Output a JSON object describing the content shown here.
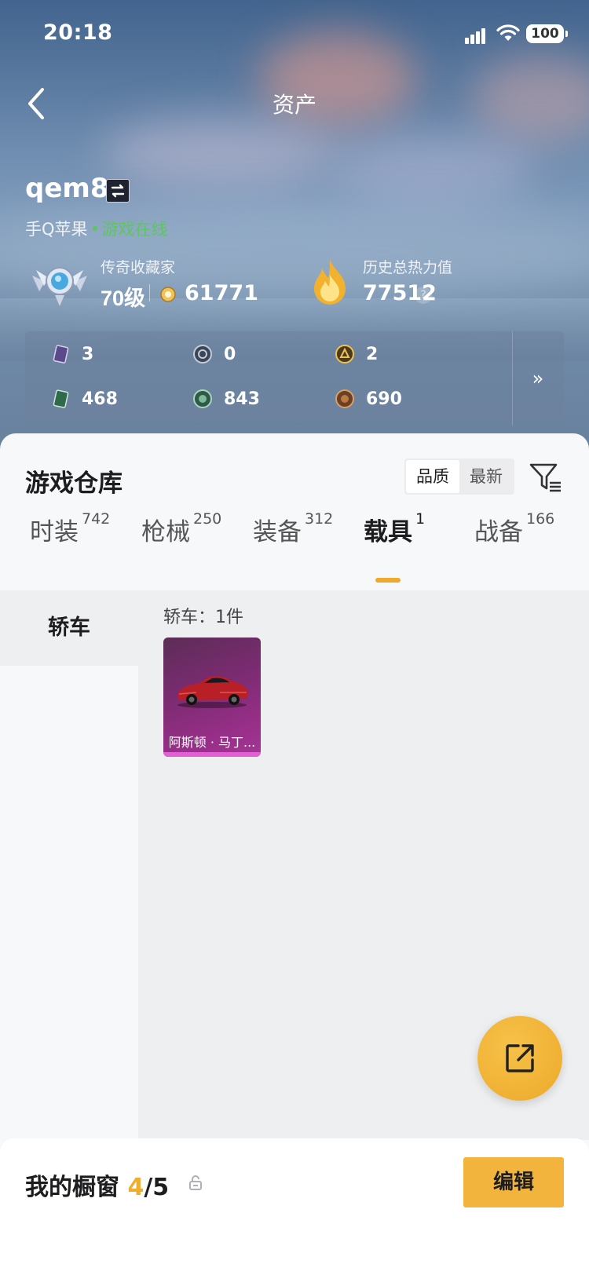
{
  "status_bar": {
    "time": "20:18",
    "battery": "100"
  },
  "nav": {
    "title": "资产"
  },
  "profile": {
    "username": "qem8",
    "platform": "手Q苹果",
    "online_status": "游戏在线",
    "collector_title": "传奇收藏家",
    "level": "70级",
    "points": "61771",
    "heat_label": "历史总热力值",
    "heat_value": "77512",
    "help": "?"
  },
  "stats": [
    {
      "value": "3",
      "icon": "purple-card-icon"
    },
    {
      "value": "0",
      "icon": "silver-coin-icon"
    },
    {
      "value": "2",
      "icon": "gold-coin-icon"
    },
    {
      "value": "468",
      "icon": "green-card-icon"
    },
    {
      "value": "843",
      "icon": "green-coin-icon"
    },
    {
      "value": "690",
      "icon": "bronze-coin-icon"
    }
  ],
  "stats_more": "»",
  "warehouse": {
    "title": "游戏仓库",
    "sort_options": [
      "品质",
      "最新"
    ],
    "tabs": [
      {
        "label": "时装",
        "count": "742"
      },
      {
        "label": "枪械",
        "count": "250"
      },
      {
        "label": "装备",
        "count": "312"
      },
      {
        "label": "载具",
        "count": "1"
      },
      {
        "label": "战备",
        "count": "166"
      }
    ],
    "active_tab": 3,
    "sidebar": [
      {
        "label": "轿车"
      }
    ],
    "category_count": "轿车：1件",
    "items": [
      {
        "name": "阿斯顿 · 马丁...",
        "rarity_color": "#9a2f8a"
      }
    ]
  },
  "showcase": {
    "title": "我的橱窗",
    "count_current": "4",
    "count_total": "/5",
    "edit_label": "编辑"
  },
  "colors": {
    "accent": "#f2b43c",
    "online": "#5bc85b"
  }
}
